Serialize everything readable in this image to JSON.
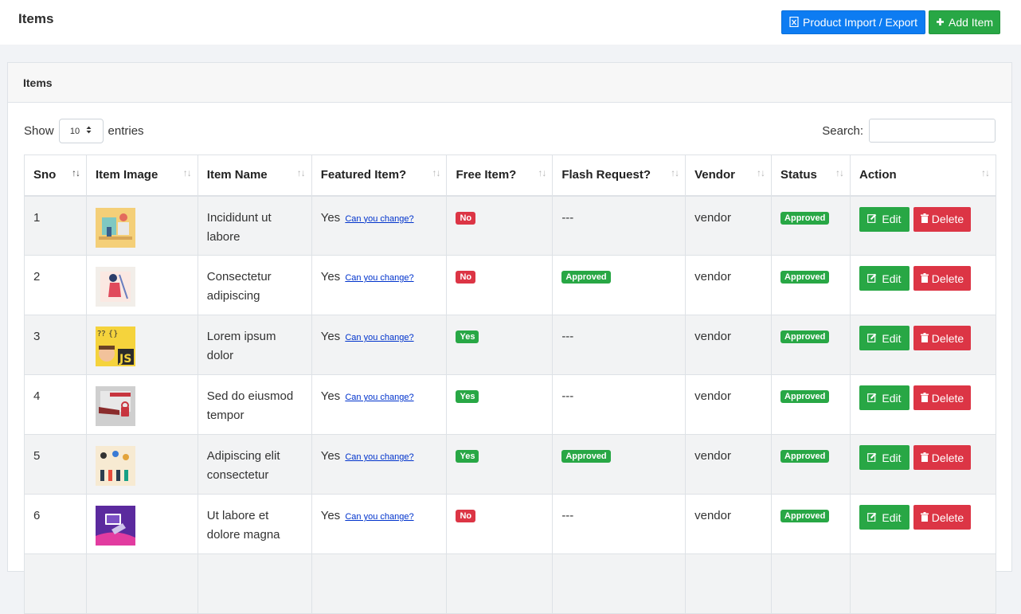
{
  "header": {
    "title": "Items",
    "import_label": "Product Import / Export",
    "add_label": "Add Item"
  },
  "card": {
    "title": "Items"
  },
  "controls": {
    "show_label": "Show",
    "entries_value": "10",
    "entries_label": "entries",
    "search_label": "Search:",
    "search_value": ""
  },
  "table": {
    "columns": [
      "Sno",
      "Item Image",
      "Item Name",
      "Featured Item?",
      "Free Item?",
      "Flash Request?",
      "Vendor",
      "Status",
      "Action"
    ],
    "change_link_label": "Can you change?",
    "edit_label": "Edit",
    "delete_label": "Delete",
    "rows": [
      {
        "sno": "1",
        "name": "Incididunt ut labore",
        "featured": "Yes",
        "free": "No",
        "flash": "---",
        "vendor": "vendor",
        "status": "Approved"
      },
      {
        "sno": "2",
        "name": "Consectetur adipiscing",
        "featured": "Yes",
        "free": "No",
        "flash": "Approved",
        "vendor": "vendor",
        "status": "Approved"
      },
      {
        "sno": "3",
        "name": "Lorem ipsum dolor",
        "featured": "Yes",
        "free": "Yes",
        "flash": "---",
        "vendor": "vendor",
        "status": "Approved"
      },
      {
        "sno": "4",
        "name": "Sed do eiusmod tempor",
        "featured": "Yes",
        "free": "Yes",
        "flash": "---",
        "vendor": "vendor",
        "status": "Approved"
      },
      {
        "sno": "5",
        "name": "Adipiscing elit consectetur",
        "featured": "Yes",
        "free": "Yes",
        "flash": "Approved",
        "vendor": "vendor",
        "status": "Approved"
      },
      {
        "sno": "6",
        "name": "Ut labore et dolore magna",
        "featured": "Yes",
        "free": "No",
        "flash": "---",
        "vendor": "vendor",
        "status": "Approved"
      }
    ]
  },
  "colors": {
    "primary": "#0d7cf2",
    "success": "#28a745",
    "danger": "#dc3545"
  }
}
